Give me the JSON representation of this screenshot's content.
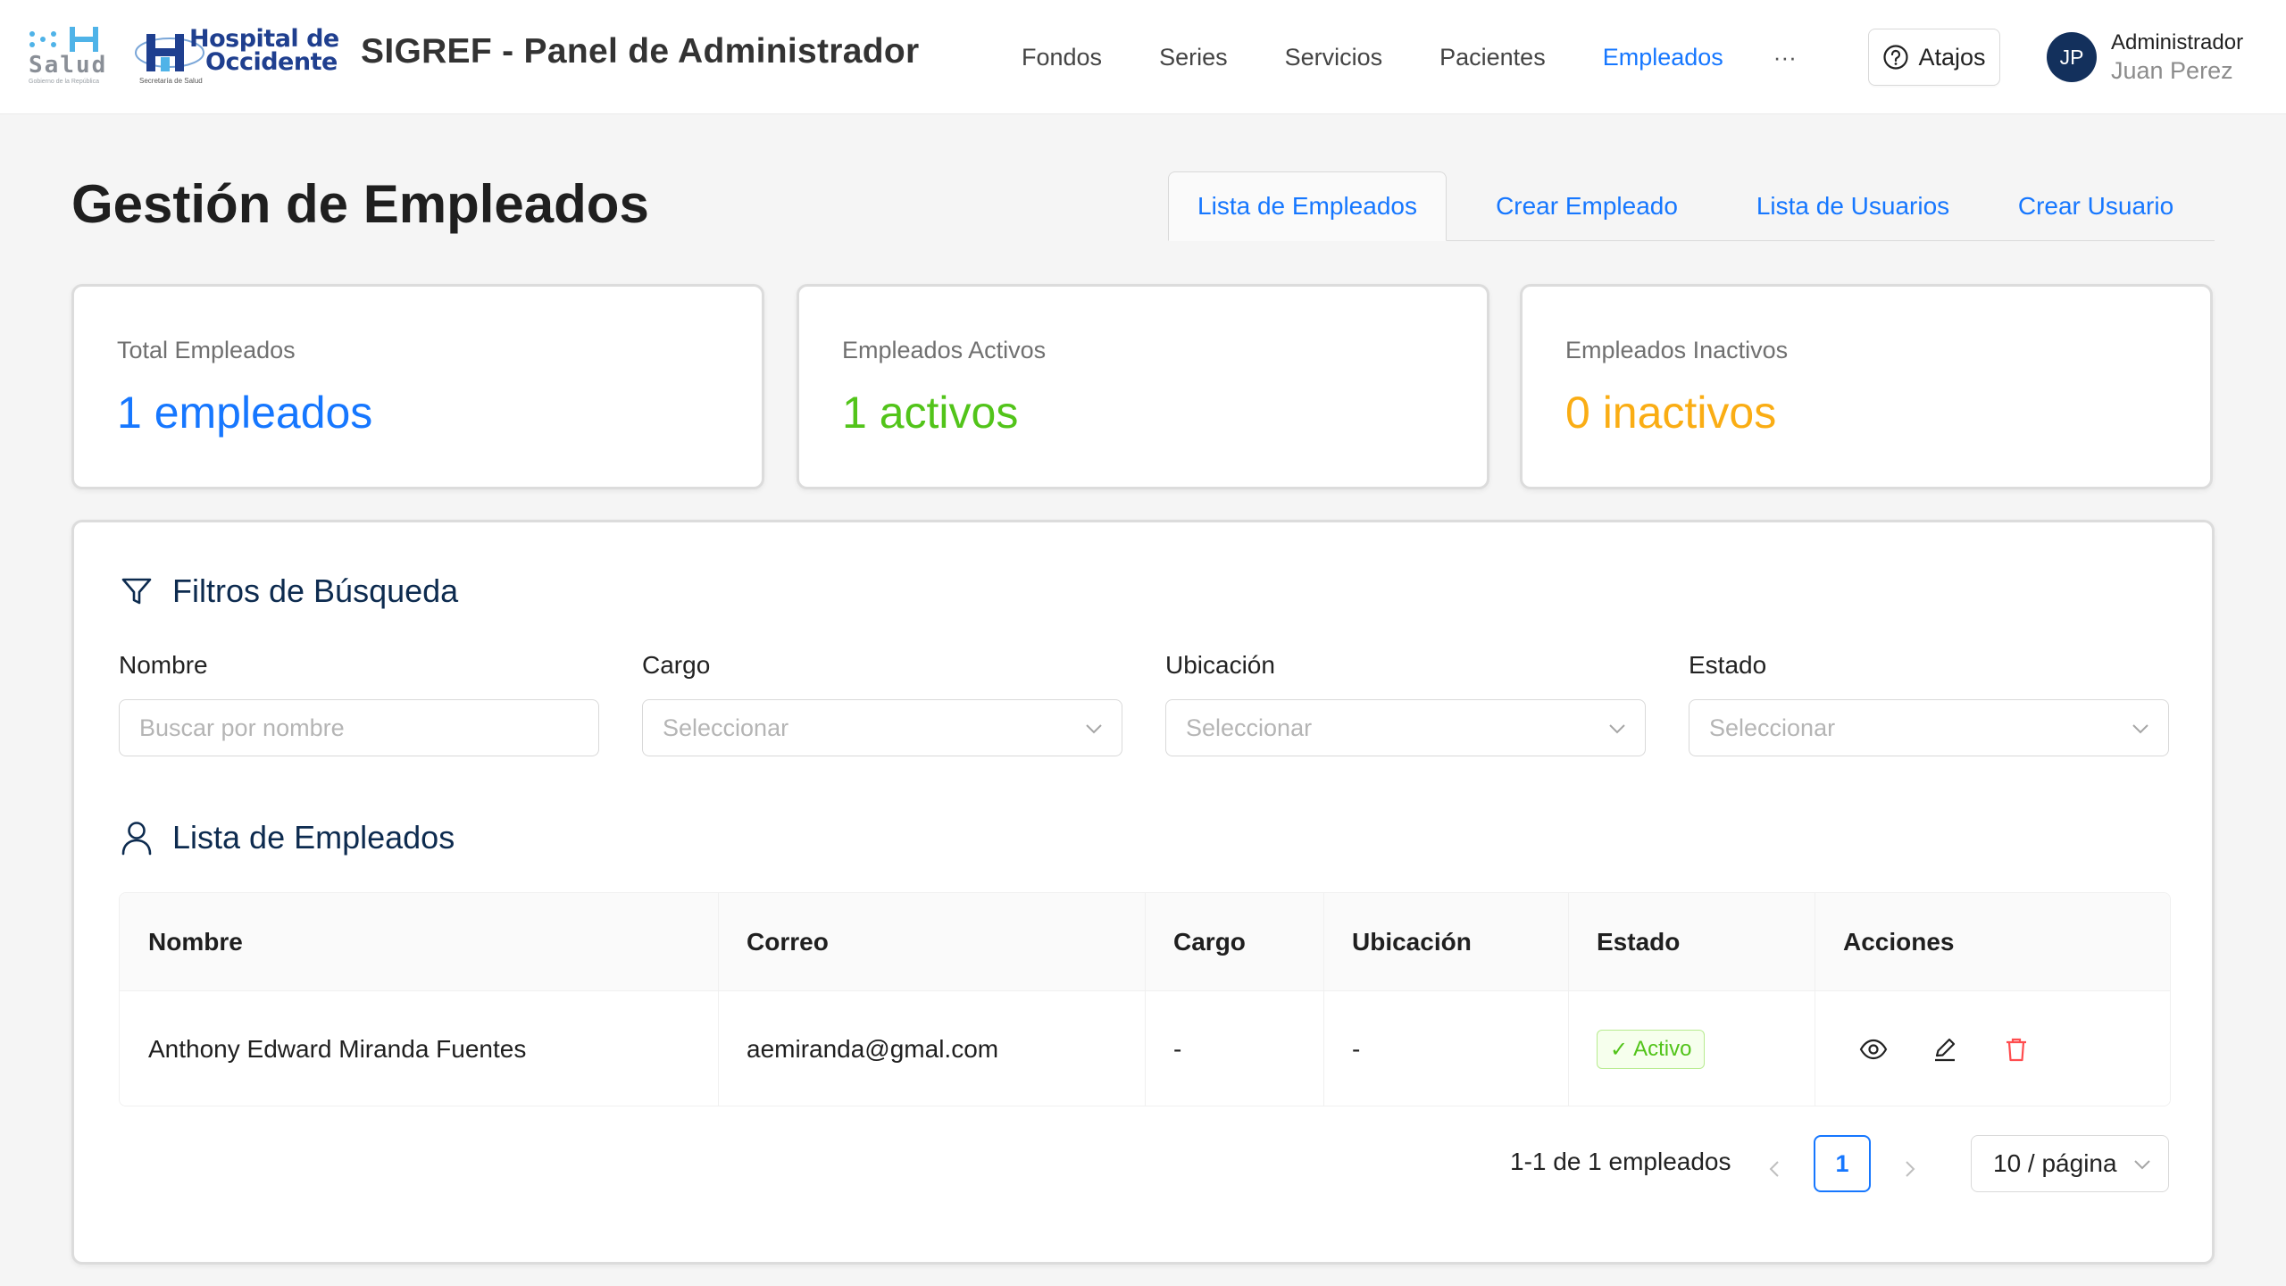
{
  "header": {
    "logo_salud": {
      "text": "Salud",
      "subtext": "Gobierno de la República"
    },
    "logo_hospital": {
      "line1": "Hospital de",
      "line2": "Occidente",
      "subtext": "Secretaría de Salud"
    },
    "app_title": "SIGREF - Panel de Administrador",
    "nav": [
      {
        "label": "Fondos"
      },
      {
        "label": "Series"
      },
      {
        "label": "Servicios"
      },
      {
        "label": "Pacientes"
      },
      {
        "label": "Empleados",
        "active": true
      }
    ],
    "more_label": "···",
    "shortcuts_label": "Atajos",
    "user": {
      "initials": "JP",
      "role": "Administrador",
      "name": "Juan Perez"
    }
  },
  "page": {
    "title": "Gestión de Empleados",
    "tabs": [
      {
        "label": "Lista de Empleados",
        "active": true
      },
      {
        "label": "Crear Empleado"
      },
      {
        "label": "Lista de Usuarios"
      },
      {
        "label": "Crear Usuario"
      }
    ]
  },
  "stats": [
    {
      "label": "Total Empleados",
      "value": "1 empleados",
      "color": "#1677ff"
    },
    {
      "label": "Empleados Activos",
      "value": "1 activos",
      "color": "#52c41a"
    },
    {
      "label": "Empleados Inactivos",
      "value": "0 inactivos",
      "color": "#faad14"
    }
  ],
  "filters": {
    "title": "Filtros de Búsqueda",
    "fields": [
      {
        "label": "Nombre",
        "placeholder": "Buscar por nombre",
        "type": "input"
      },
      {
        "label": "Cargo",
        "placeholder": "Seleccionar",
        "type": "select"
      },
      {
        "label": "Ubicación",
        "placeholder": "Seleccionar",
        "type": "select"
      },
      {
        "label": "Estado",
        "placeholder": "Seleccionar",
        "type": "select"
      }
    ]
  },
  "employees": {
    "title": "Lista de Empleados",
    "columns": [
      "Nombre",
      "Correo",
      "Cargo",
      "Ubicación",
      "Estado",
      "Acciones"
    ],
    "rows": [
      {
        "nombre": "Anthony Edward Miranda Fuentes",
        "correo": "aemiranda@gmal.com",
        "cargo": "-",
        "ubicacion": "-",
        "estado": "Activo",
        "estado_mark": "✓",
        "actions": [
          "eye-icon",
          "edit-icon",
          "delete-icon"
        ]
      }
    ]
  },
  "pagination": {
    "total_text": "1-1 de 1 empleados",
    "current_page": "1",
    "page_size": "10 / página"
  },
  "colors": {
    "accent": "#1677ff",
    "success": "#52c41a",
    "warning": "#faad14",
    "danger": "#ff4d4f",
    "navy": "#0d2b4f",
    "avatar": "#13305c"
  }
}
